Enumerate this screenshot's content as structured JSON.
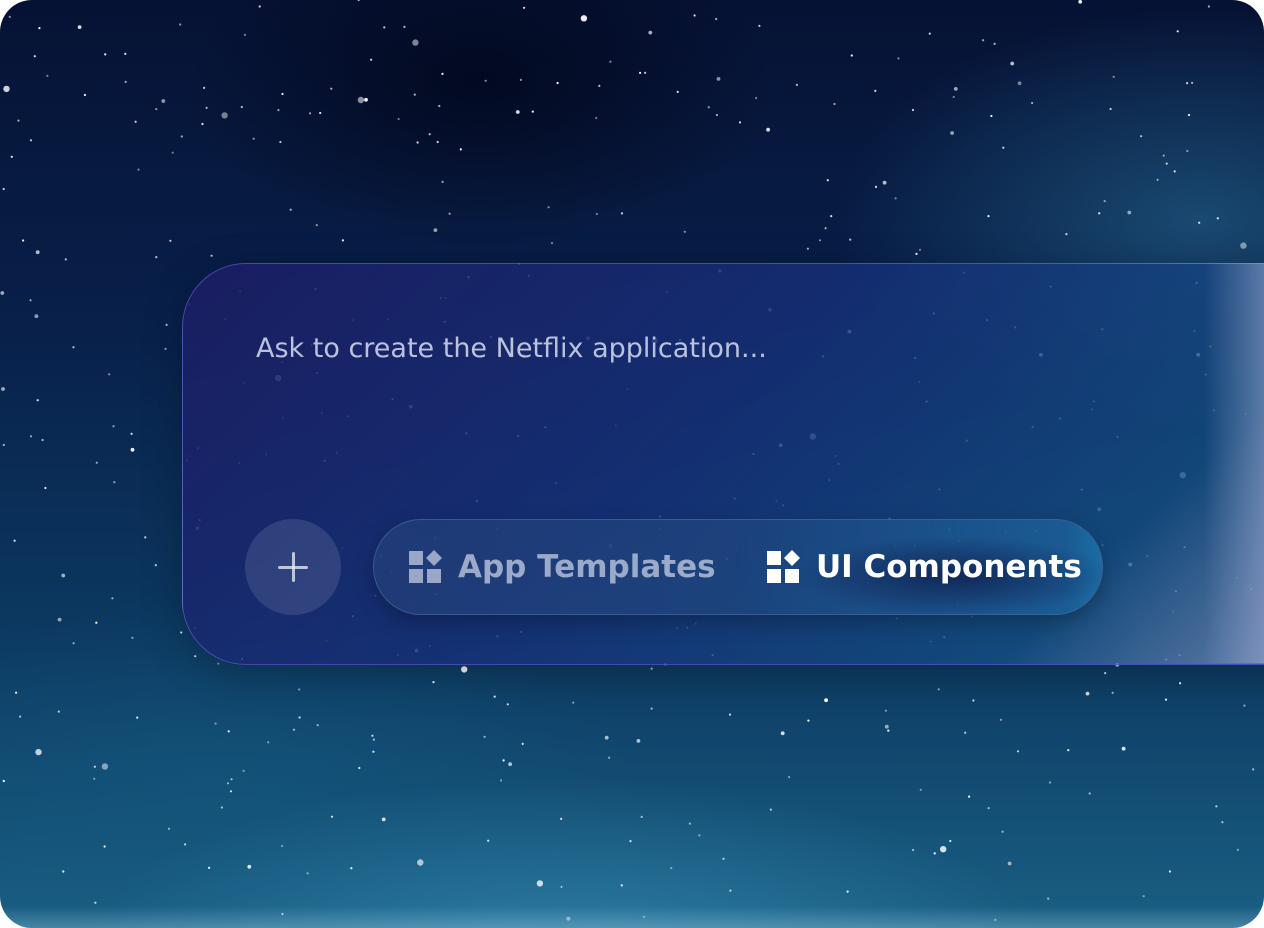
{
  "prompt": {
    "placeholder": "Ask to create the Netflix application..."
  },
  "toolbar": {
    "add_icon": "plus-icon",
    "tabs": [
      {
        "label": "App Templates",
        "icon": "widgets-icon",
        "selected": false
      },
      {
        "label": "UI Components",
        "icon": "widgets-icon",
        "selected": true
      }
    ]
  },
  "colors": {
    "background_top": "#061234",
    "background_bottom": "#1a5f84",
    "card_border": "#6e64dc",
    "selected_text": "#ffffff",
    "unselected_text": "#cdd4e8"
  }
}
